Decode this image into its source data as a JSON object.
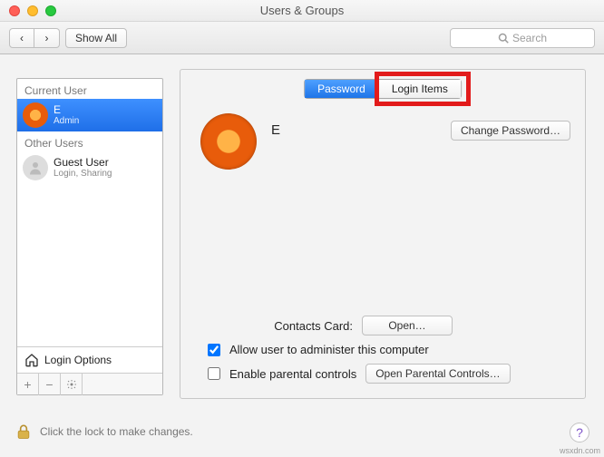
{
  "window": {
    "title": "Users & Groups"
  },
  "toolbar": {
    "back_glyph": "‹",
    "forward_glyph": "›",
    "show_all": "Show All",
    "search_placeholder": "Search"
  },
  "sidebar": {
    "current_label": "Current User",
    "other_label": "Other Users",
    "current_user": {
      "name": "E",
      "role": "Admin"
    },
    "other_users": [
      {
        "name": "Guest User",
        "role": "Login, Sharing"
      }
    ],
    "login_options": "Login Options"
  },
  "tabs": {
    "password": "Password",
    "login_items": "Login Items"
  },
  "main": {
    "display_name": "E",
    "change_password": "Change Password…",
    "contacts_label": "Contacts Card:",
    "open_button": "Open…",
    "admin_checkbox": "Allow user to administer this computer",
    "parental_checkbox": "Enable parental controls",
    "parental_button": "Open Parental Controls…"
  },
  "footer": {
    "lock_text": "Click the lock to make changes."
  },
  "watermark": "wsxdn.com"
}
